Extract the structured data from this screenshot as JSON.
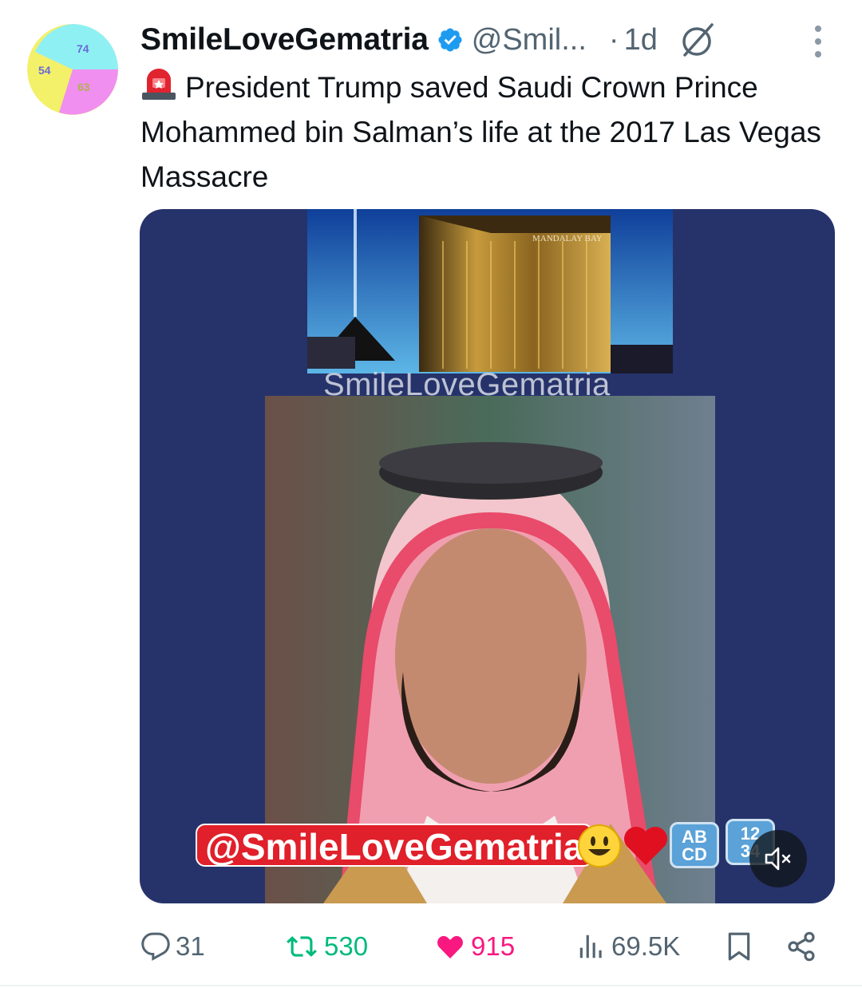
{
  "tweet": {
    "author": {
      "display_name": "SmileLoveGematria",
      "handle": "@Smil...",
      "verified": true,
      "avatar_numbers": [
        "74",
        "54",
        "63"
      ]
    },
    "separator": "·",
    "age": "1d",
    "text": "President Trump saved Saudi Crown Prince Mohammed bin Salman’s life at the 2017 Las Vegas Massacre",
    "media": {
      "sign_text": "MANDALAY BAY",
      "watermark": "SmileLoveGematria",
      "overlay_handle": "@SmileLoveGematria",
      "key_abcd": [
        "AB",
        "CD"
      ],
      "key_1234": [
        "12",
        "34"
      ]
    },
    "stats": {
      "replies": "31",
      "reposts": "530",
      "likes": "915",
      "views": "69.5K"
    }
  },
  "colors": {
    "text": "#0f1419",
    "secondary": "#536471",
    "verified": "#1d9bf0",
    "repost": "#00ba7c",
    "like": "#f91880",
    "media_background": "#26336b"
  },
  "icons": {
    "reply": "reply-bubble-icon",
    "repost": "repost-arrows-icon",
    "like": "heart-filled-icon",
    "views": "bar-chart-icon",
    "bookmark": "bookmark-icon",
    "share": "share-icon",
    "more": "more-vertical-icon",
    "grok": "grok-icon",
    "siren": "siren-emoji-icon",
    "mute": "speaker-muted-icon"
  }
}
